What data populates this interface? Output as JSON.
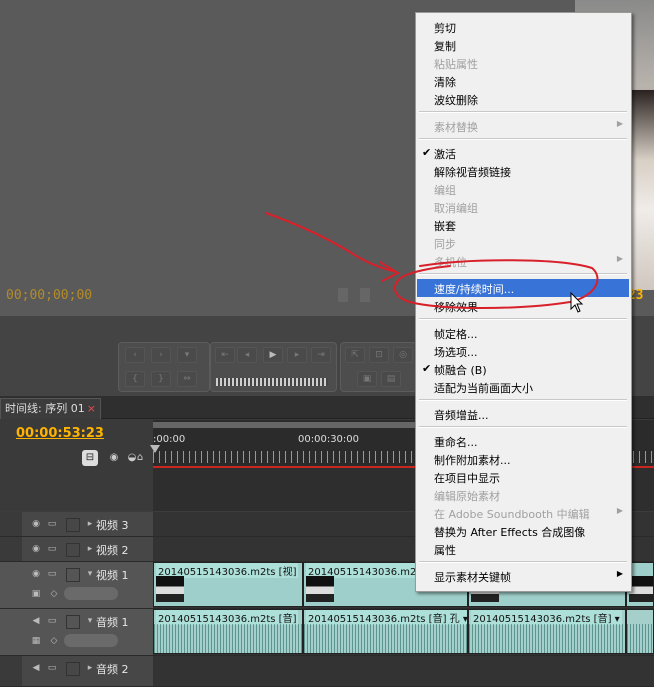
{
  "monitor": {
    "timecode_left": "00;00;00;00",
    "timecode_right": ":23"
  },
  "timeline": {
    "tab_label": "时间线: 序列 01",
    "tab_close": "×",
    "playhead_timecode": "00:00:53:23",
    "ruler_labels": [
      ":00:00",
      "00:00:30:00"
    ],
    "tracks": [
      {
        "name": "视频 3"
      },
      {
        "name": "视频 2"
      },
      {
        "name": "视频 1"
      },
      {
        "name": "音频 1"
      },
      {
        "name": "音频 2"
      }
    ],
    "video_clips": [
      {
        "label": "20140515143036.m2ts [视]"
      },
      {
        "label": "20140515143036.m2ts [视]"
      }
    ],
    "audio_clips": [
      {
        "label": "20140515143036.m2ts [音]"
      },
      {
        "label": "20140515143036.m2ts [音] 孔 ▾"
      },
      {
        "label": "20140515143036.m2ts [音] ▾"
      }
    ]
  },
  "context_menu": {
    "items": [
      {
        "label": "剪切",
        "enabled": true
      },
      {
        "label": "复制",
        "enabled": true
      },
      {
        "label": "粘贴属性",
        "enabled": false
      },
      {
        "label": "清除",
        "enabled": true
      },
      {
        "label": "波纹删除",
        "enabled": true
      },
      {
        "label": "素材替换",
        "enabled": false,
        "submenu": true
      },
      {
        "label": "激活",
        "enabled": true,
        "checked": true
      },
      {
        "label": "解除视音频链接",
        "enabled": true
      },
      {
        "label": "编组",
        "enabled": false
      },
      {
        "label": "取消编组",
        "enabled": false
      },
      {
        "label": "嵌套",
        "enabled": true
      },
      {
        "label": "同步",
        "enabled": false
      },
      {
        "label": "多机位",
        "enabled": false,
        "submenu": true
      },
      {
        "label": "速度/持续时间...",
        "enabled": true,
        "highlighted": true
      },
      {
        "label": "移除效果",
        "enabled": true
      },
      {
        "label": "帧定格...",
        "enabled": true
      },
      {
        "label": "场选项...",
        "enabled": true
      },
      {
        "label": "帧融合 (B)",
        "enabled": true,
        "checked": true
      },
      {
        "label": "适配为当前画面大小",
        "enabled": true
      },
      {
        "label": "音频增益...",
        "enabled": true
      },
      {
        "label": "重命名...",
        "enabled": true
      },
      {
        "label": "制作附加素材...",
        "enabled": true
      },
      {
        "label": "在项目中显示",
        "enabled": true
      },
      {
        "label": "编辑原始素材",
        "enabled": false
      },
      {
        "label": "在 Adobe Soundbooth 中编辑",
        "enabled": false,
        "submenu": true
      },
      {
        "label": "替换为 After Effects 合成图像",
        "enabled": true
      },
      {
        "label": "属性",
        "enabled": true
      },
      {
        "label": "显示素材关键帧",
        "enabled": true,
        "submenu": true
      }
    ],
    "check_glyph": "✔",
    "submenu_glyph": "▶"
  },
  "colors": {
    "timecode": "#ffb400",
    "menu_highlight": "#3874d8",
    "annotation": "#d8202a",
    "clip": "#9fcfca"
  }
}
